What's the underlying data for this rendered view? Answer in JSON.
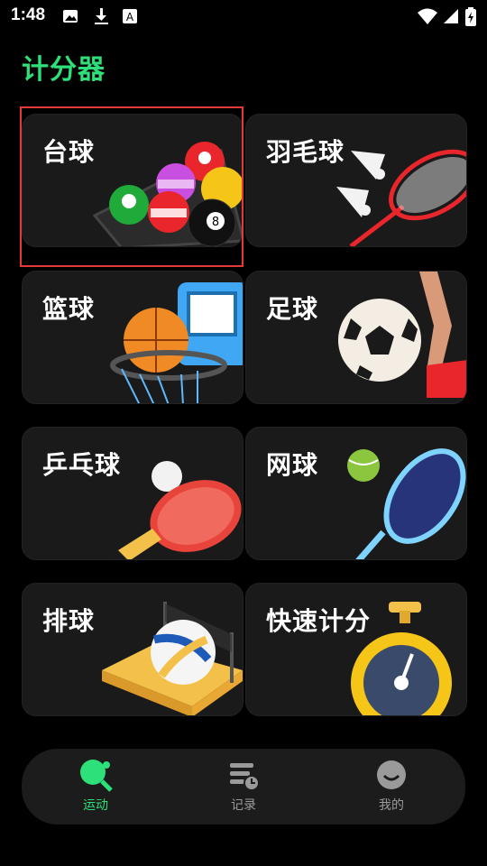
{
  "status_bar": {
    "time": "1:48"
  },
  "app": {
    "title": "计分器"
  },
  "sports": [
    {
      "label": "台球",
      "icon": "billiards-balls-icon",
      "selected": true
    },
    {
      "label": "羽毛球",
      "icon": "badminton-racket-icon"
    },
    {
      "label": "篮球",
      "icon": "basketball-hoop-icon"
    },
    {
      "label": "足球",
      "icon": "soccer-ball-icon"
    },
    {
      "label": "乒乓球",
      "icon": "ping-pong-paddle-icon"
    },
    {
      "label": "网球",
      "icon": "tennis-racket-icon"
    },
    {
      "label": "排球",
      "icon": "volleyball-court-icon"
    },
    {
      "label": "快速计分",
      "icon": "stopwatch-icon"
    }
  ],
  "nav": [
    {
      "label": "运动",
      "icon": "ping-pong-icon",
      "active": true
    },
    {
      "label": "记录",
      "icon": "records-icon"
    },
    {
      "label": "我的",
      "icon": "profile-smile-icon"
    }
  ],
  "colors": {
    "accent": "#2ee07a",
    "selection_border": "#e53935",
    "card_bg": "#1a1a1a",
    "nav_bg": "#1c1c1c"
  }
}
